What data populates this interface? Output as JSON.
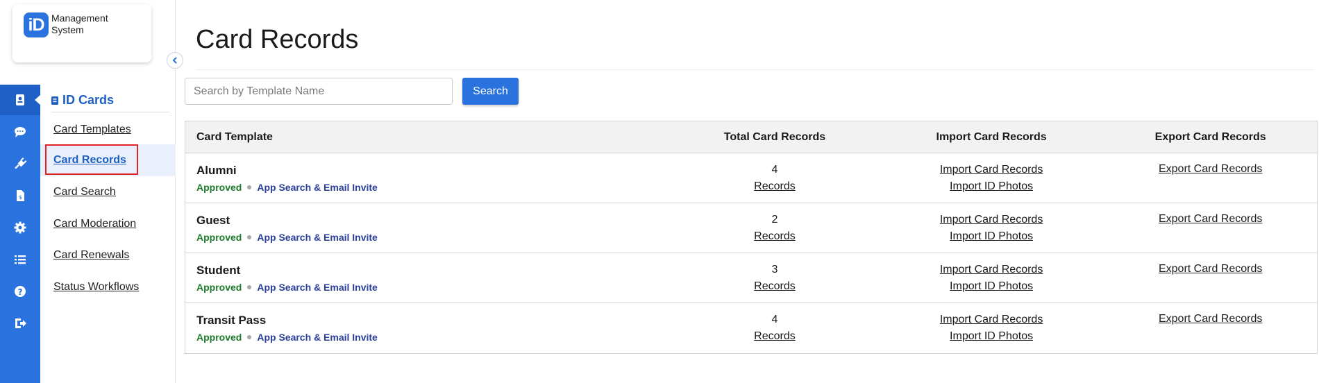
{
  "logo": {
    "badge": "iD",
    "text": "Management System"
  },
  "rail": {
    "icons": [
      "id-card-icon",
      "chat-icon",
      "plug-icon",
      "invoice-icon",
      "gear-icon",
      "list-icon",
      "help-icon",
      "logout-icon"
    ]
  },
  "sidebar": {
    "section_title": "ID Cards",
    "items": [
      {
        "label": "Card Templates"
      },
      {
        "label": "Card Records"
      },
      {
        "label": "Card Search"
      },
      {
        "label": "Card Moderation"
      },
      {
        "label": "Card Renewals"
      },
      {
        "label": "Status Workflows"
      }
    ]
  },
  "main": {
    "title": "Card Records",
    "search": {
      "placeholder": "Search by Template Name",
      "button": "Search"
    },
    "table": {
      "headers": [
        "Card Template",
        "Total Card Records",
        "Import Card Records",
        "Export Card Records"
      ],
      "rows": [
        {
          "name": "Alumni",
          "status": "Approved",
          "access": "App Search & Email Invite",
          "count": "4",
          "records_link": "Records",
          "import_records": "Import Card Records",
          "import_photos": "Import ID Photos",
          "export": "Export Card Records"
        },
        {
          "name": "Guest",
          "status": "Approved",
          "access": "App Search & Email Invite",
          "count": "2",
          "records_link": "Records",
          "import_records": "Import Card Records",
          "import_photos": "Import ID Photos",
          "export": "Export Card Records"
        },
        {
          "name": "Student",
          "status": "Approved",
          "access": "App Search & Email Invite",
          "count": "3",
          "records_link": "Records",
          "import_records": "Import Card Records",
          "import_photos": "Import ID Photos",
          "export": "Export Card Records"
        },
        {
          "name": "Transit Pass",
          "status": "Approved",
          "access": "App Search & Email Invite",
          "count": "4",
          "records_link": "Records",
          "import_records": "Import Card Records",
          "import_photos": "Import ID Photos",
          "export": "Export Card Records"
        }
      ]
    }
  },
  "colors": {
    "brand": "#2a72de",
    "status_approved": "#1d7a2a",
    "access_link": "#2a3f9e",
    "highlight": "#e02424"
  }
}
